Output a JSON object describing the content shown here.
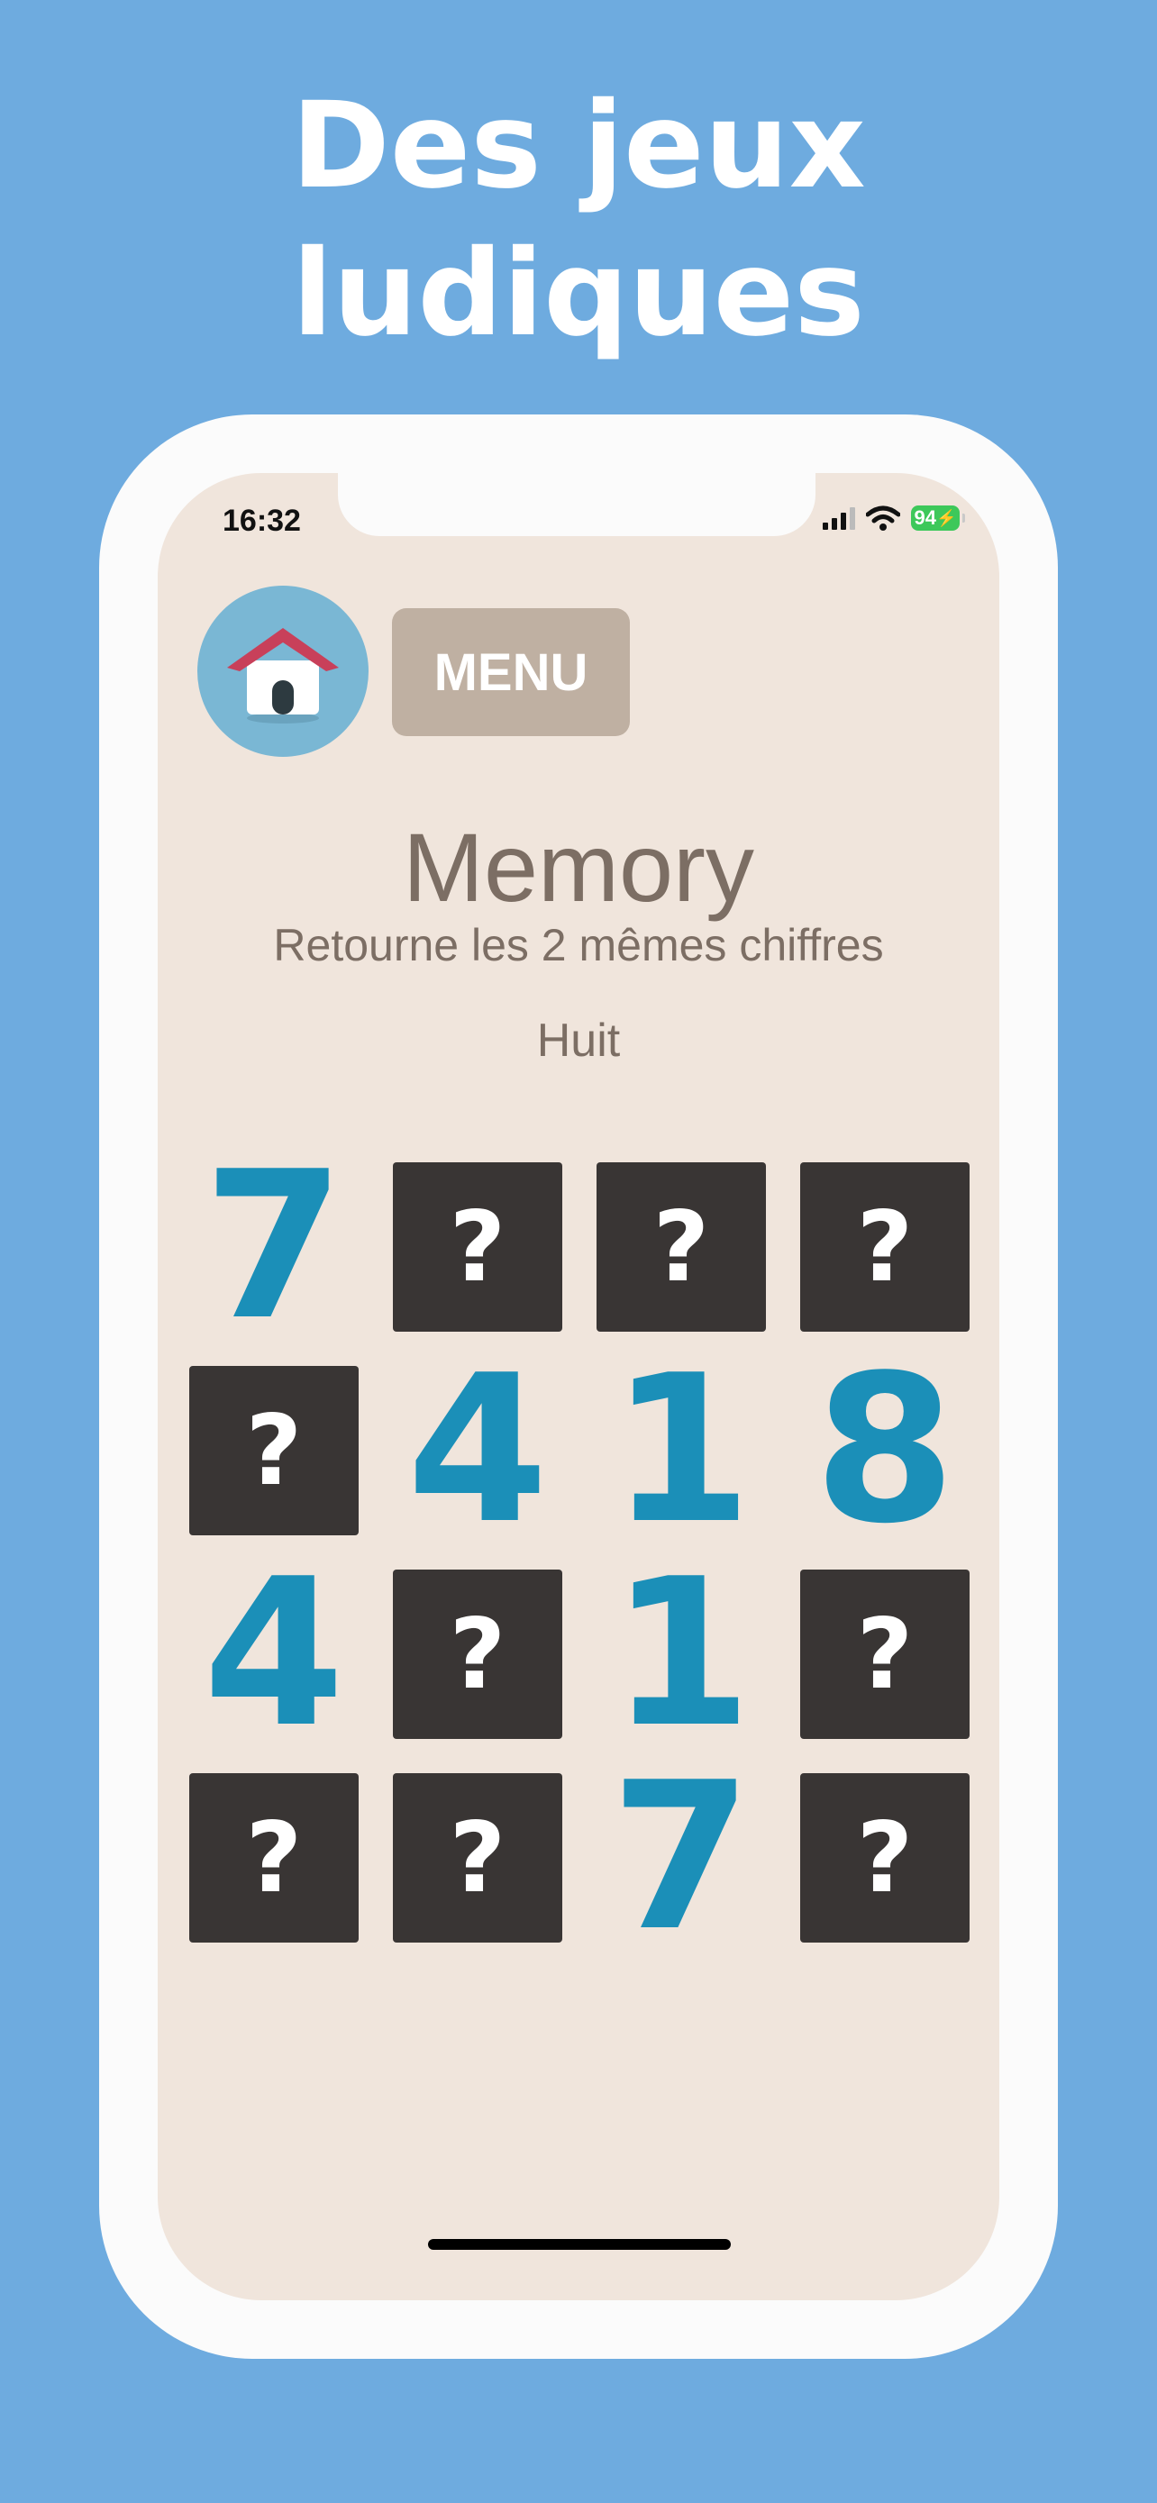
{
  "headline": {
    "line1": "Des jeux",
    "line2": "ludiques"
  },
  "status_bar": {
    "time": "16:32",
    "battery": "94"
  },
  "toolbar": {
    "home_icon": "house-icon",
    "menu_label": "MENU"
  },
  "game": {
    "title": "Memory",
    "subtitle": "Retourne les 2 mêmes chiffres",
    "target_word": "Huit",
    "cards": [
      {
        "face": "7",
        "state": "revealed"
      },
      {
        "face": "?",
        "state": "hidden"
      },
      {
        "face": "?",
        "state": "hidden"
      },
      {
        "face": "?",
        "state": "hidden"
      },
      {
        "face": "?",
        "state": "hidden"
      },
      {
        "face": "4",
        "state": "revealed"
      },
      {
        "face": "1",
        "state": "revealed"
      },
      {
        "face": "8",
        "state": "revealed"
      },
      {
        "face": "4",
        "state": "revealed"
      },
      {
        "face": "?",
        "state": "hidden"
      },
      {
        "face": "1",
        "state": "revealed"
      },
      {
        "face": "?",
        "state": "hidden"
      },
      {
        "face": "?",
        "state": "hidden"
      },
      {
        "face": "?",
        "state": "hidden"
      },
      {
        "face": "7",
        "state": "revealed"
      },
      {
        "face": "?",
        "state": "hidden"
      }
    ]
  },
  "colors": {
    "background": "#6eabdf",
    "screen": "#f0e5dc",
    "card_back": "#393534",
    "digit": "#1b8fb8",
    "menu_button": "#bfb0a2",
    "home_button": "#7ab7d4"
  }
}
